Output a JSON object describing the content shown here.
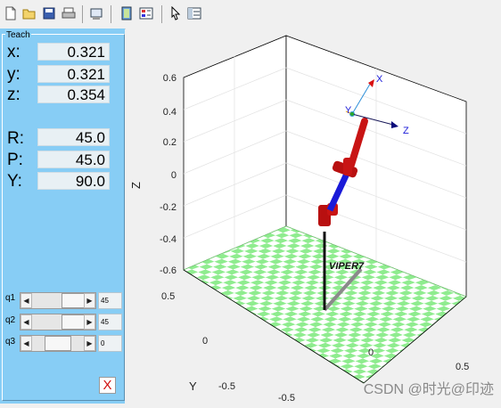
{
  "toolbar": {
    "icons": [
      "new-icon",
      "open-icon",
      "save-icon",
      "print-icon",
      "print-preview-icon",
      "figure-icon",
      "figure-panel-icon",
      "pointer-icon",
      "property-inspector-icon"
    ]
  },
  "teach": {
    "title": "Teach",
    "position": [
      {
        "label": "x:",
        "value": "0.321"
      },
      {
        "label": "y:",
        "value": "0.321"
      },
      {
        "label": "z:",
        "value": "0.354"
      }
    ],
    "orientation": [
      {
        "label": "R:",
        "value": "45.0"
      },
      {
        "label": "P:",
        "value": "45.0"
      },
      {
        "label": "Y:",
        "value": "90.0"
      }
    ],
    "joints": [
      {
        "label": "q1",
        "value": "45"
      },
      {
        "label": "q2",
        "value": "45"
      },
      {
        "label": "q3",
        "value": "0"
      }
    ],
    "close_label": "X"
  },
  "plot": {
    "zlabel": "Z",
    "ylabel": "Y",
    "z_ticks": [
      "0.6",
      "0.4",
      "0.2",
      "0",
      "-0.2",
      "-0.4",
      "-0.6"
    ],
    "y_ticks": [
      "0.5",
      "0",
      "-0.5"
    ],
    "x_ticks": [
      "-0.5",
      "0",
      "0.5"
    ],
    "robot_name": "VIPER7",
    "frame_labels": {
      "x": "X",
      "y": "Y",
      "z": "Z"
    }
  },
  "watermark": "CSDN @时光@印迹",
  "colors": {
    "panel": "#87cdf5",
    "link": "#c81414",
    "joint": "#1a1ad8",
    "floor": "#8fec8f"
  }
}
